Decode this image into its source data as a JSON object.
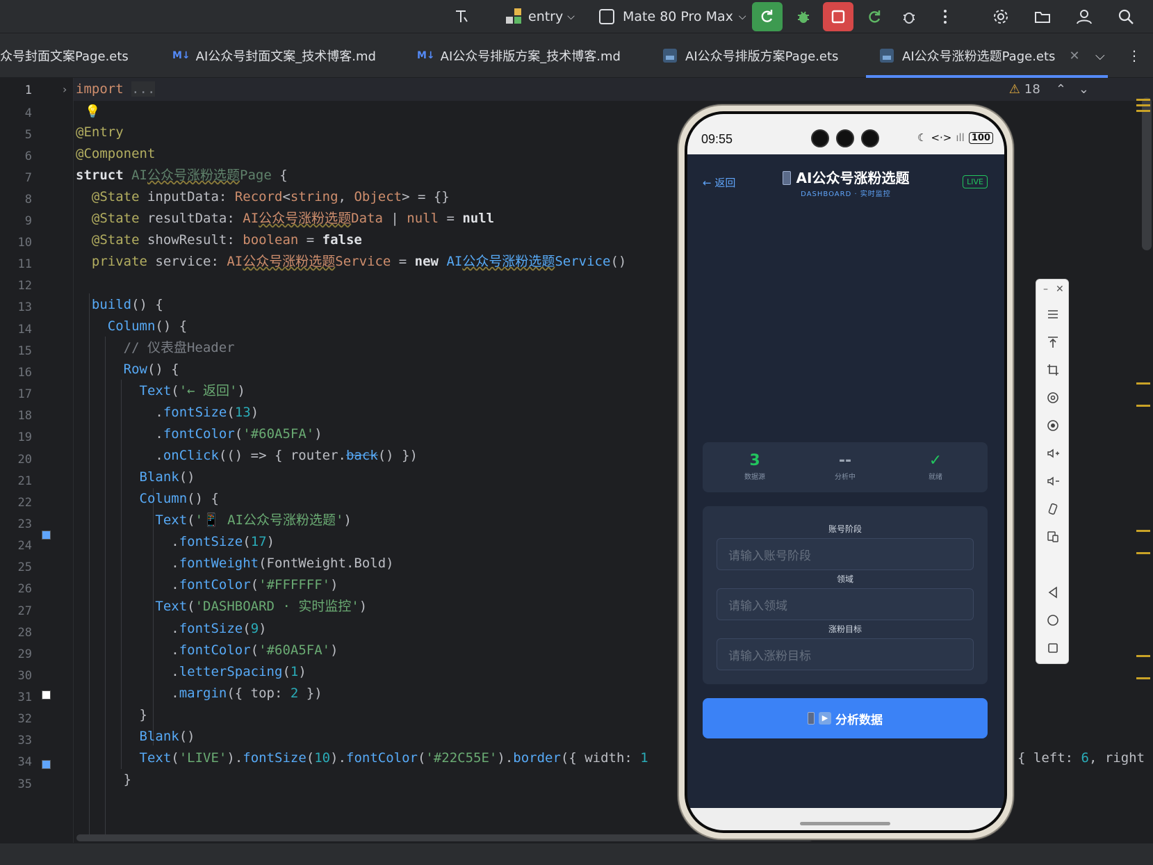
{
  "toolbar": {
    "module": "entry",
    "device": "Mate 80 Pro Max"
  },
  "tabs": [
    {
      "label": "众号封面文案Page.ets",
      "kind": "ets"
    },
    {
      "label": "AI公众号封面文案_技术博客.md",
      "kind": "md",
      "badge": "M↓"
    },
    {
      "label": "AI公众号排版方案_技术博客.md",
      "kind": "md",
      "badge": "M↓"
    },
    {
      "label": "AI公众号排版方案Page.ets",
      "kind": "ets"
    },
    {
      "label": "AI公众号涨粉选题Page.ets",
      "kind": "ets",
      "active": true
    }
  ],
  "editor": {
    "warning_count": "18",
    "line_numbers": [
      "1",
      "4",
      "5",
      "6",
      "7",
      "8",
      "9",
      "10",
      "11",
      "12",
      "13",
      "14",
      "15",
      "16",
      "17",
      "18",
      "19",
      "20",
      "21",
      "22",
      "23",
      "24",
      "25",
      "26",
      "27",
      "28",
      "29",
      "30",
      "31",
      "32",
      "33",
      "34",
      "35"
    ],
    "colors": {
      "blue_swatch": "#60A5FA",
      "white_swatch": "#FFFFFF",
      "green_swatch": "#22C55E"
    }
  },
  "phone": {
    "status": {
      "time": "09:55",
      "battery": "100"
    },
    "header": {
      "back": "← 返回",
      "title": "AI公众号涨粉选题",
      "subtitle": "DASHBOARD · 实时监控",
      "live": "LIVE"
    },
    "stats": [
      {
        "value": "3",
        "label": "数据源"
      },
      {
        "value": "--",
        "label": "分析中"
      },
      {
        "value": "✓",
        "label": "就绪"
      }
    ],
    "form": {
      "fields": [
        {
          "label": "账号阶段",
          "placeholder": "请输入账号阶段"
        },
        {
          "label": "领域",
          "placeholder": "请输入领域"
        },
        {
          "label": "涨粉目标",
          "placeholder": "请输入涨粉目标"
        }
      ]
    },
    "analyze_button": "分析数据",
    "accent": "#3B82F6"
  }
}
